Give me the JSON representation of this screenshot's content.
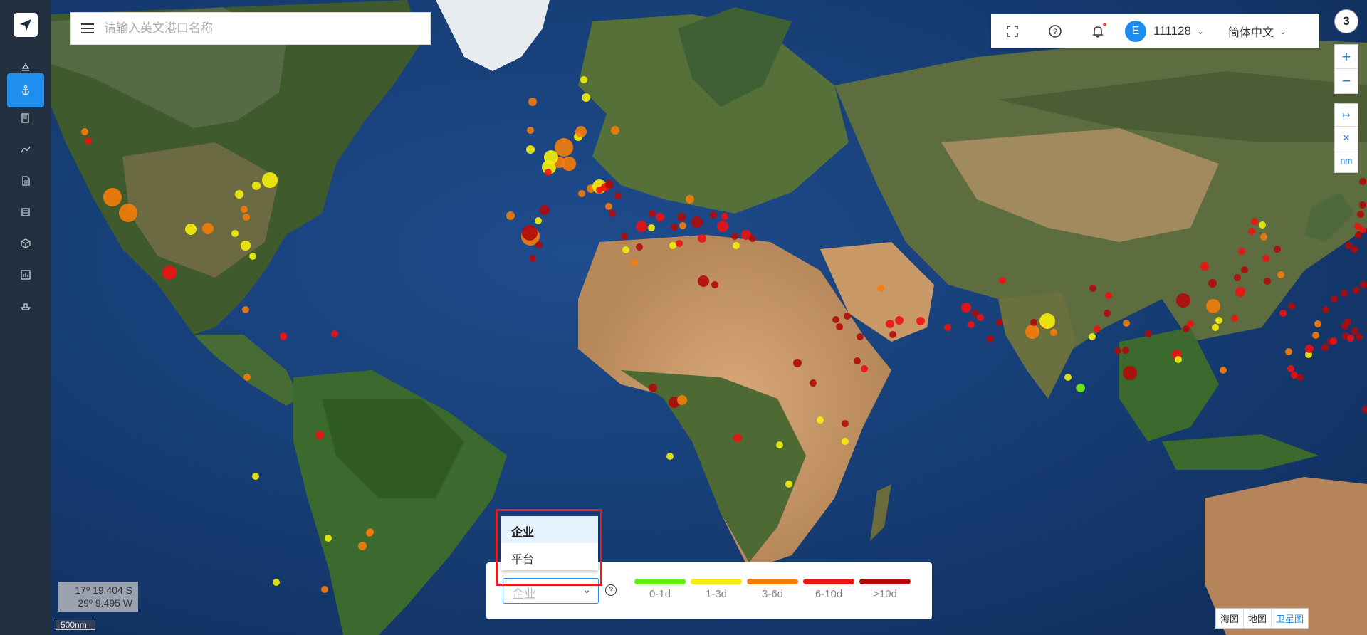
{
  "search": {
    "placeholder": "请输入英文港口名称"
  },
  "sidebar": {
    "items": [
      {
        "icon": "port-ship-icon"
      },
      {
        "icon": "anchor-icon",
        "active": true
      },
      {
        "icon": "document-edit-icon"
      },
      {
        "icon": "route-icon"
      },
      {
        "icon": "file-icon"
      },
      {
        "icon": "list-icon"
      },
      {
        "icon": "cube-icon"
      },
      {
        "icon": "chart-icon"
      },
      {
        "icon": "vessel-icon"
      }
    ]
  },
  "topbar": {
    "user_initial": "E",
    "username": "111128",
    "language": "简体中文"
  },
  "badge_count": "3",
  "zoom": {
    "in": "+",
    "out": "−"
  },
  "tools": {
    "measure": "↦",
    "clear": "✕",
    "unit": "nm"
  },
  "coords": {
    "lat": "17º 19.404 S",
    "lon": "29º 9.495 W"
  },
  "scale": "500nm",
  "maptype": [
    "海图",
    "地图",
    "卫星图"
  ],
  "maptype_active": "卫星图",
  "legend": {
    "select_value": "企业",
    "help": "?",
    "items": [
      {
        "label": "0-1d",
        "color": "#5ff014"
      },
      {
        "label": "1-3d",
        "color": "#f4f00a"
      },
      {
        "label": "3-6d",
        "color": "#f57c0a"
      },
      {
        "label": "6-10d",
        "color": "#ee1111"
      },
      {
        "label": ">10d",
        "color": "#b00a0a"
      }
    ]
  },
  "dropdown": {
    "options": [
      "企业",
      "平台"
    ],
    "selected": "企业"
  },
  "colors": {
    "accent": "#1e8cf0",
    "sidebar": "#233040",
    "highlight": "#e0201f"
  }
}
